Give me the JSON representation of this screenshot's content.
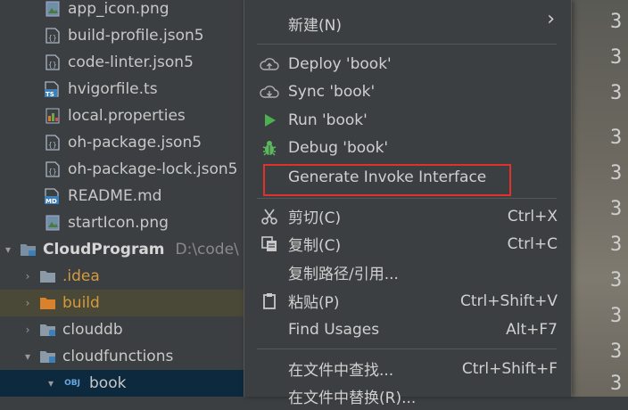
{
  "tree": {
    "items": [
      {
        "label": "app_icon.png",
        "icon": "image-file-icon"
      },
      {
        "label": "build-profile.json5",
        "icon": "json-file-icon"
      },
      {
        "label": "code-linter.json5",
        "icon": "json-file-icon"
      },
      {
        "label": "hvigorfile.ts",
        "icon": "ts-file-icon",
        "badge": "TS"
      },
      {
        "label": "local.properties",
        "icon": "properties-file-icon"
      },
      {
        "label": "oh-package.json5",
        "icon": "json-file-icon"
      },
      {
        "label": "oh-package-lock.json5",
        "icon": "json-file-icon"
      },
      {
        "label": "README.md",
        "icon": "markdown-file-icon",
        "badge": "MD"
      },
      {
        "label": "startIcon.png",
        "icon": "image-file-icon"
      }
    ],
    "root": {
      "label": "CloudProgram",
      "path": "D:\\code\\"
    },
    "folders": [
      {
        "label": ".idea"
      },
      {
        "label": "build"
      },
      {
        "label": "clouddb"
      },
      {
        "label": "cloudfunctions"
      },
      {
        "label": "book",
        "badge": "OBJ"
      }
    ]
  },
  "gutter": {
    "digit": "3"
  },
  "menu": {
    "new": {
      "label": "新建(N)",
      "arrow": "›"
    },
    "deploy": {
      "label": "Deploy 'book'"
    },
    "sync": {
      "label": "Sync 'book'"
    },
    "run": {
      "label": "Run 'book'"
    },
    "debug": {
      "label": "Debug 'book'"
    },
    "generate": {
      "label": "Generate Invoke Interface"
    },
    "cut": {
      "label": "剪切(C)",
      "shortcut": "Ctrl+X"
    },
    "copy": {
      "label": "复制(C)",
      "shortcut": "Ctrl+C"
    },
    "copy_path": {
      "label": "复制路径/引用..."
    },
    "paste": {
      "label": "粘贴(P)",
      "shortcut": "Ctrl+Shift+V"
    },
    "find_usages": {
      "label": "Find Usages",
      "shortcut": "Alt+F7"
    },
    "find_in_files": {
      "label": "在文件中查找...",
      "shortcut": "Ctrl+Shift+F"
    },
    "replace_in_files": {
      "label": "在文件中替换(R)..."
    }
  },
  "colors": {
    "highlight_box": "#e0312d",
    "run_green": "#4caf50",
    "debug_green": "#5cb85c"
  }
}
